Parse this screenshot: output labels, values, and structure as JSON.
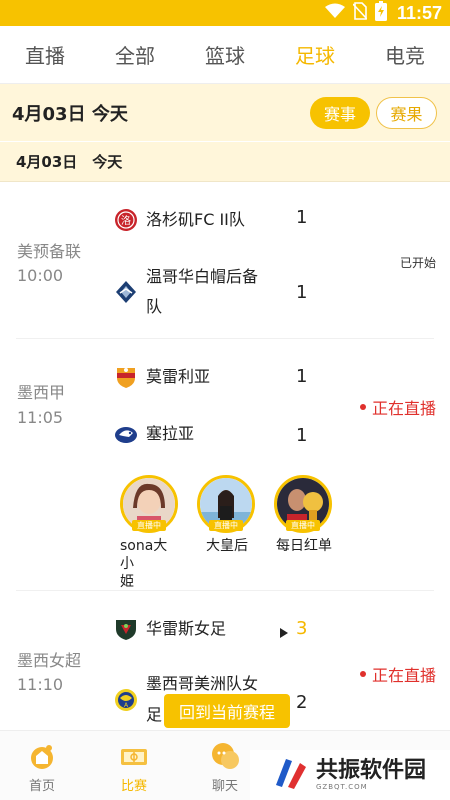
{
  "status_bar": {
    "time": "11:57"
  },
  "tabs": [
    {
      "label": "直播",
      "active": false
    },
    {
      "label": "全部",
      "active": false
    },
    {
      "label": "篮球",
      "active": false
    },
    {
      "label": "足球",
      "active": true
    },
    {
      "label": "电竞",
      "active": false
    }
  ],
  "date_header": {
    "label": "4月03日 今天",
    "btn_events": "赛事",
    "btn_results": "赛果"
  },
  "date_sub": {
    "label": "4月03日　今天"
  },
  "matches": [
    {
      "league": "美预备联",
      "time": "10:00",
      "home": {
        "name": "洛杉矶FC II队",
        "score": "1",
        "logo": "lafc-logo-icon"
      },
      "away": {
        "name_line1": "温哥华白帽后备",
        "name_line2": "队",
        "score": "1",
        "logo": "whitecaps-logo-icon"
      },
      "status": "已开始"
    },
    {
      "league": "墨西甲",
      "time": "11:05",
      "home": {
        "name": "莫雷利亚",
        "score": "1",
        "logo": "morelia-logo-icon"
      },
      "away": {
        "name": "塞拉亚",
        "score": "1",
        "logo": "celaya-logo-icon"
      },
      "status": "正在直播",
      "anchors": [
        {
          "name_line1": "sona大小",
          "name_line2": "姫",
          "tag": "直播中"
        },
        {
          "name_line1": "大皇后",
          "tag": "直播中"
        },
        {
          "name_line1": "每日红单",
          "tag": "直播中"
        }
      ]
    },
    {
      "league": "墨西女超",
      "time": "11:10",
      "home": {
        "name": "华雷斯女足",
        "score": "3",
        "logo": "juarez-logo-icon"
      },
      "away": {
        "name_line1": "墨西哥美洲队女",
        "name_line2": "足",
        "score": "2",
        "logo": "america-logo-icon"
      },
      "status": "正在直播"
    }
  ],
  "float_button": "回到当前赛程",
  "bottom_nav": [
    {
      "label": "首页",
      "active": false
    },
    {
      "label": "比赛",
      "active": true
    },
    {
      "label": "聊天",
      "active": false
    }
  ],
  "watermark": {
    "title": "共振软件园",
    "sub": "GZBQT.COM"
  },
  "colors": {
    "brand": "#f7c200",
    "live": "#e0302c",
    "date_bg": "#fff6da"
  }
}
